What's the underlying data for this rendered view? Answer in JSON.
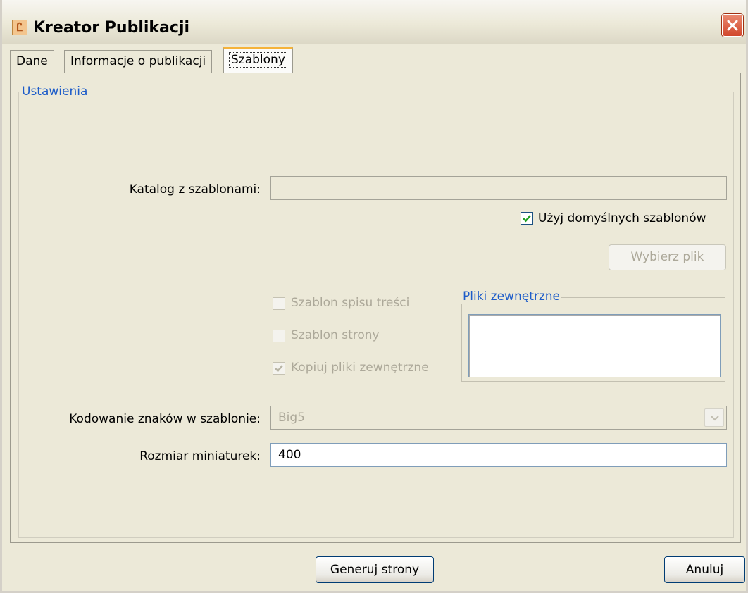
{
  "window": {
    "title": "Kreator Publikacji",
    "icon": "app-icon",
    "icon_glyph": "Ꮭ"
  },
  "tabs": [
    {
      "label": "Dane",
      "active": false
    },
    {
      "label": "Informacje o publikacji",
      "active": false
    },
    {
      "label": "Szablony",
      "active": true
    }
  ],
  "settings": {
    "group_title": "Ustawienia",
    "template_dir": {
      "label": "Katalog z szablonami:",
      "value": ""
    },
    "use_default_templates": {
      "label": "Użyj domyślnych szablonów",
      "checked": true
    },
    "choose_file_button": "Wybierz plik",
    "toc_template": {
      "label": "Szablon spisu treści",
      "checked": false,
      "enabled": false
    },
    "page_template": {
      "label": "Szablon strony",
      "checked": false,
      "enabled": false
    },
    "copy_external": {
      "label": "Kopiuj pliki zewnętrzne",
      "checked": true,
      "enabled": false
    },
    "external_files": {
      "title": "Pliki zewnętrzne",
      "items": []
    },
    "encoding": {
      "label": "Kodowanie znaków w szablonie:",
      "value": "Big5"
    },
    "thumb_size": {
      "label": "Rozmiar miniaturek:",
      "value": "400"
    }
  },
  "footer": {
    "generate_button": "Generuj strony",
    "cancel_button": "Anuluj"
  },
  "colors": {
    "accent_blue": "#1d5cc9",
    "tab_highlight": "#f5b33a",
    "close_red": "#d1472c",
    "window_bg": "#ece9d8"
  }
}
